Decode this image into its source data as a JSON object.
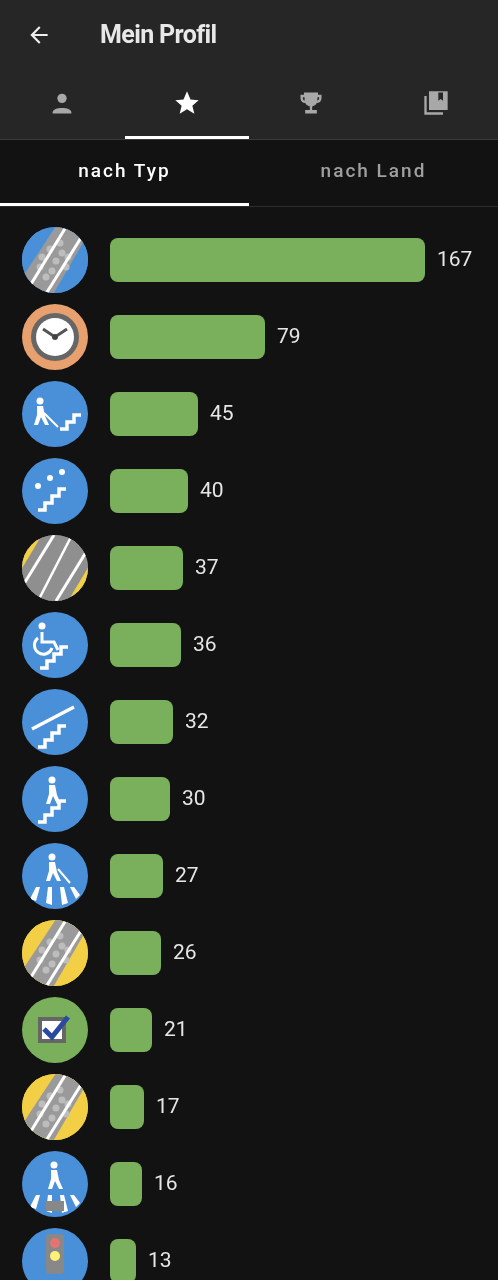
{
  "app_bar": {
    "title": "Mein Profil"
  },
  "tabs": [
    {
      "selected": false
    },
    {
      "selected": true
    },
    {
      "selected": false
    },
    {
      "selected": false
    }
  ],
  "sub_tabs": [
    {
      "label": "nach Typ",
      "selected": true
    },
    {
      "label": "nach Land",
      "selected": false
    }
  ],
  "stats": [
    {
      "count": "167"
    },
    {
      "count": "79"
    },
    {
      "count": "45"
    },
    {
      "count": "40"
    },
    {
      "count": "37"
    },
    {
      "count": "36"
    },
    {
      "count": "32"
    },
    {
      "count": "30"
    },
    {
      "count": "27"
    },
    {
      "count": "26"
    },
    {
      "count": "21"
    },
    {
      "count": "17"
    },
    {
      "count": "16"
    },
    {
      "count": "13"
    }
  ]
}
